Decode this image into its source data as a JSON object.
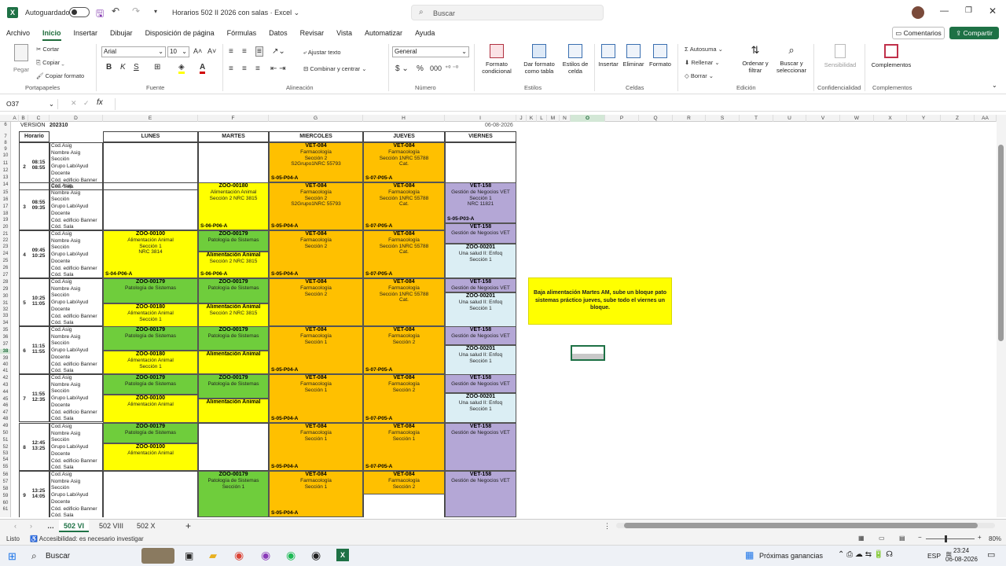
{
  "titlebar": {
    "autosave": "Autoguardado",
    "file": "Horarios 502 II 2026 con salas",
    "app": "Excel",
    "search": "Buscar"
  },
  "menu": [
    "Archivo",
    "Inicio",
    "Insertar",
    "Dibujar",
    "Disposición de página",
    "Fórmulas",
    "Datos",
    "Revisar",
    "Vista",
    "Automatizar",
    "Ayuda"
  ],
  "menu_active": "Inicio",
  "buttons": {
    "comments": "Comentarios",
    "share": "Compartir"
  },
  "ribbon": {
    "paste": "Pegar",
    "cut": "Cortar",
    "copy": "Copiar",
    "format_painter": "Copiar formato",
    "clipboard": "Portapapeles",
    "font_name": "Arial",
    "font_size": "10",
    "font_group": "Fuente",
    "wrap": "Ajustar texto",
    "merge": "Combinar y centrar",
    "align_group": "Alineación",
    "num_format": "General",
    "num_group": "Número",
    "cond_format": "Formato condicional",
    "table_format": "Dar formato como tabla",
    "cell_styles": "Estilos de celda",
    "styles_group": "Estilos",
    "insert": "Insertar",
    "delete": "Eliminar",
    "format": "Formato",
    "cells_group": "Celdas",
    "autosum": "Autosuma",
    "fill": "Rellenar",
    "clear": "Borrar",
    "sort": "Ordenar y filtrar",
    "find": "Buscar y seleccionar",
    "edit_group": "Edición",
    "sensitivity": "Sensibilidad",
    "conf_group": "Confidencialidad",
    "addins": "Complementos",
    "addins_group": "Complementos"
  },
  "namebox": "O37",
  "columns": [
    "A",
    "B",
    "C",
    "D",
    "E",
    "F",
    "G",
    "H",
    "I",
    "J",
    "K",
    "L",
    "M",
    "N",
    "O",
    "P",
    "Q",
    "R",
    "S",
    "T",
    "U",
    "V",
    "W",
    "X",
    "Y",
    "Z",
    "AA"
  ],
  "header_row": {
    "version_label": "VERSIÓN",
    "version": "202310",
    "date": "06-08-2026"
  },
  "days": [
    "Horario",
    "LUNES",
    "MARTES",
    "MIERCOLES",
    "JUEVES",
    "VIERNES"
  ],
  "row_labels": [
    "Cod.Asig",
    "Nombre Asig",
    "Sección",
    "Grupo Lab/Ayud",
    "Docente",
    "Cód. edificio Banner",
    "Cód. Sala"
  ],
  "blocks": [
    {
      "n": "2",
      "time": "08:15 08:55"
    },
    {
      "n": "3",
      "time": "08:55 09:35"
    },
    {
      "n": "4",
      "time": "09:45 10:25"
    },
    {
      "n": "5",
      "time": "10:25 11:05"
    },
    {
      "n": "6",
      "time": "11:15 11:55"
    },
    {
      "n": "7",
      "time": "11:55 12:35"
    },
    {
      "n": "8",
      "time": "12:45 13:25"
    },
    {
      "n": "9",
      "time": "13:25 14:05"
    }
  ],
  "note": "Baja alimentación Martes AM, sube un bloque pato sistemas práctico jueves, sube todo el viernes un bloque.",
  "sheets": [
    "502 VI",
    "502 VIII",
    "502 X"
  ],
  "status": {
    "ready": "Listo",
    "access": "Accesibilidad: es necesario investigar",
    "zoom": "80%"
  },
  "taskbar": {
    "search": "Buscar",
    "news": "Próximas ganancias",
    "lang": "ESP",
    "time": "23:24",
    "date": "06-08-2026"
  },
  "c": {
    "zoo180": "ZOO-00180",
    "alim": "Alimentación Animal",
    "sec2nrc3815": "Sección 2 NRC 3815",
    "zoo100": "ZOO-00100",
    "sec1": "Sección 1",
    "nrc3814": "NRC 3814",
    "zoo179": "ZOO-00179",
    "pato": "Patología de Sistemas",
    "vet084": "VET-084",
    "farma": "Farmacología",
    "sec2": "Sección 2",
    "s2g": "S2Grupo1NRC 55793",
    "sec1nrc": "Sección 1NRC 55788",
    "cat": "Cat.",
    "vet158": "VET-158",
    "gestion": "Gestión de Negocios VET",
    "nrc11821": "NRC 11821",
    "zoo201": "ZOO-00201",
    "unasalud": "Una salud II: Enfoq",
    "s0505": "S-05-P04-A",
    "s0705": "S-07-P05-A",
    "s0406": "S-06-P06-A",
    "s0503": "S-05-P03-A",
    "s0401": "S-04-P06-A"
  }
}
